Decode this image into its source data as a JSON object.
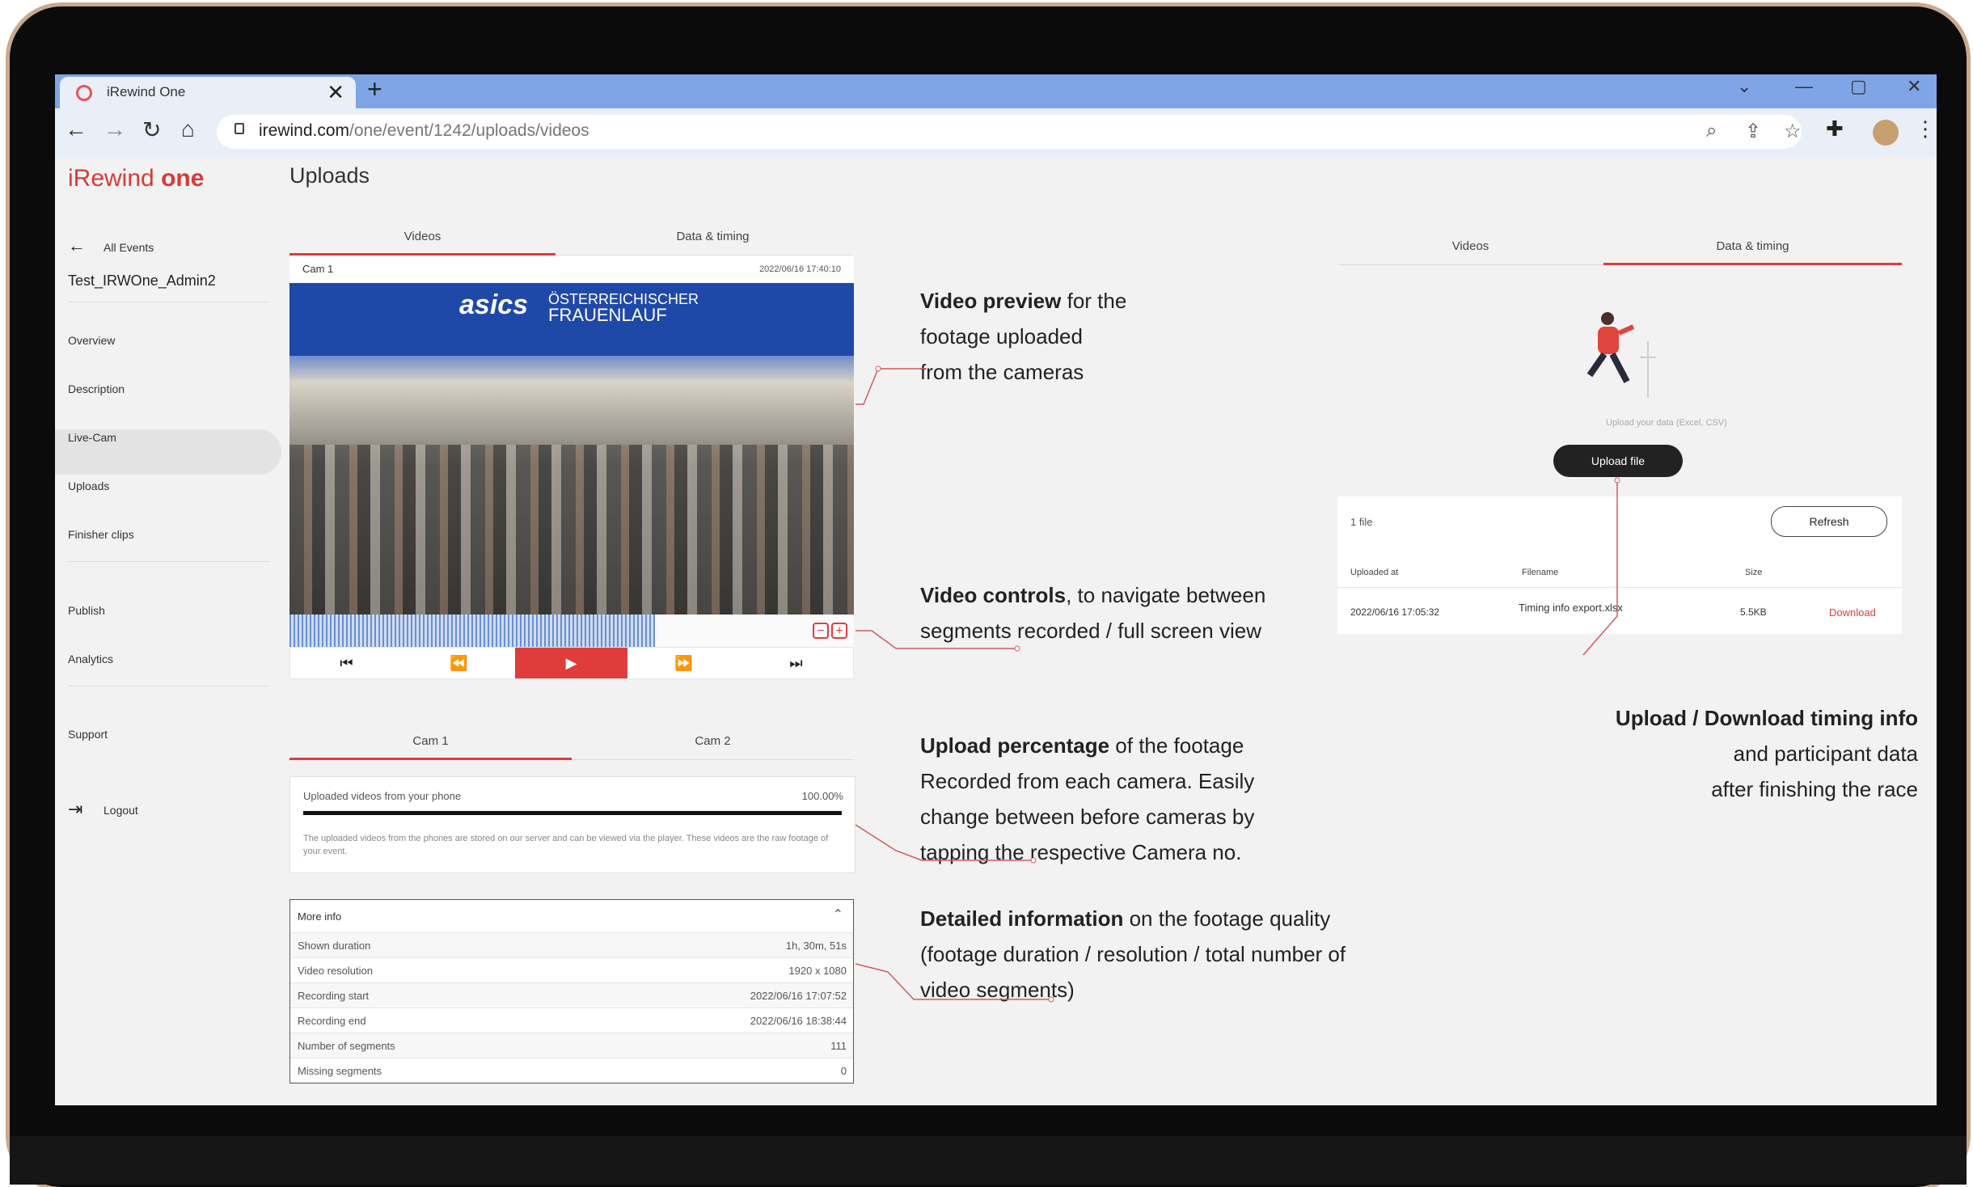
{
  "browser": {
    "tab_title": "iRewind One",
    "tab_close": "✕",
    "new_tab": "+",
    "url_host": "irewind.com",
    "url_path": "/one/event/1242/uploads/videos"
  },
  "app": {
    "logo_text": "iRewind",
    "logo_bold": "one",
    "page_title": "Uploads"
  },
  "sidebar": {
    "back_label": "All Events",
    "event_name": "Test_IRWOne_Admin2",
    "items": [
      "Overview",
      "Description",
      "Live-Cam",
      "Uploads",
      "Finisher clips",
      "Publish",
      "Analytics",
      "Support"
    ],
    "active_item": "Live-Cam",
    "logout_label": "Logout"
  },
  "tabs_main": {
    "videos": "Videos",
    "data_timing": "Data & timing"
  },
  "video_card": {
    "cam_label": "Cam 1",
    "timestamp": "2022/06/16 17:40:10",
    "brand_text": "asics",
    "event_banner_line1": "ÖSTERREICHISCHER",
    "event_banner_line2": "FRAUENLAUF"
  },
  "controls": {
    "prev": "⏮",
    "rewind": "⏪",
    "play": "▶",
    "forward": "⏩",
    "next": "⏭",
    "zoom_out": "−",
    "zoom_in": "+"
  },
  "cam_tabs": {
    "cam1": "Cam 1",
    "cam2": "Cam 2"
  },
  "upload_card": {
    "title": "Uploaded videos from your phone",
    "percent_label": "100.00%",
    "percent": 100,
    "description": "The uploaded videos from the phones are stored on our server and can be viewed via the player. These videos are the raw footage of your event."
  },
  "more_info": {
    "title": "More info",
    "rows": [
      {
        "label": "Shown duration",
        "value": "1h, 30m, 51s"
      },
      {
        "label": "Video resolution",
        "value": "1920 x 1080"
      },
      {
        "label": "Recording start",
        "value": "2022/06/16 17:07:52"
      },
      {
        "label": "Recording end",
        "value": "2022/06/16 18:38:44"
      },
      {
        "label": "Number of segments",
        "value": "111"
      },
      {
        "label": "Missing segments",
        "value": "0"
      }
    ]
  },
  "timing_panel": {
    "tab_videos": "Videos",
    "tab_data": "Data & timing",
    "upload_hint": "Upload your data (Excel, CSV)",
    "upload_button": "Upload file",
    "file_count": "1 file",
    "refresh_button": "Refresh",
    "columns": [
      "Uploaded at",
      "Filename",
      "Size"
    ],
    "row": {
      "uploaded_at": "2022/06/16 17:05:32",
      "filename": "Timing info export.xlsx",
      "size": "5.5KB",
      "action": "Download"
    }
  },
  "annotations": {
    "video_preview": {
      "bold": "Video preview",
      "line1": " for the",
      "line2": "footage uploaded",
      "line3": "from the cameras"
    },
    "video_controls": {
      "bold": "Video controls",
      "line1": ", to navigate between",
      "line2": "segments recorded / full screen view"
    },
    "upload_percentage": {
      "bold": "Upload percentage",
      "line1": " of the footage",
      "line2": "Recorded from each camera. Easily",
      "line3": "change between before cameras by",
      "line4": "tapping the respective Camera no."
    },
    "detailed_info": {
      "bold": "Detailed information",
      "line1": " on the footage quality",
      "line2": "(footage duration / resolution / total number of",
      "line3": "video segments)"
    },
    "timing_info": {
      "bold": "Upload / Download timing info",
      "line2": "and participant data",
      "line3": "after finishing the race"
    }
  },
  "colors": {
    "accent": "#e03c3c",
    "tabbar": "#7fa5e6",
    "button_dark": "#222222"
  }
}
